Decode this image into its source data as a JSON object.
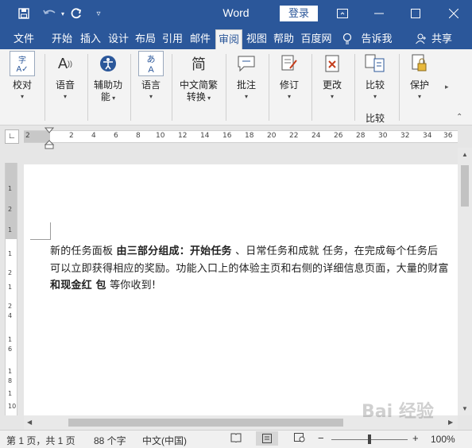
{
  "titlebar": {
    "title": "Word",
    "login_label": "登录",
    "icons": [
      "save-icon",
      "undo-icon",
      "redo-icon",
      "customize-icon",
      "ribbon-display-icon",
      "minimize-icon",
      "maximize-icon",
      "close-icon"
    ]
  },
  "tabs": [
    "文件",
    "开始",
    "插入",
    "设计",
    "布局",
    "引用",
    "邮件",
    "审阅",
    "视图",
    "帮助",
    "百度网",
    "告诉我",
    "共享"
  ],
  "active_tab": "审阅",
  "ribbon": {
    "proofing": {
      "label": "校对"
    },
    "speech": {
      "label": "语音"
    },
    "accessibility": {
      "label_line1": "辅助功",
      "label_line2": "能"
    },
    "language": {
      "label": "语言"
    },
    "chinese_conversion": {
      "label_line1": "中文简繁",
      "label_line2": "转换",
      "icon_text": "简"
    },
    "comments": {
      "label": "批注"
    },
    "tracking": {
      "label": "修订"
    },
    "changes": {
      "label": "更改"
    },
    "compare": {
      "label": "比较",
      "group_label": "比较"
    },
    "protect": {
      "label": "保护"
    }
  },
  "ruler": {
    "h_ticks": [
      "2",
      "2",
      "4",
      "6",
      "8",
      "10",
      "12",
      "14",
      "16",
      "18",
      "20",
      "22",
      "24",
      "26",
      "28",
      "30",
      "32",
      "34",
      "36"
    ],
    "v_ticks": [
      "1",
      "2",
      "1",
      "1",
      "2",
      "1",
      "2",
      "4",
      "1",
      "6",
      "1",
      "8",
      "1",
      "10"
    ]
  },
  "document": {
    "line1": {
      "a": "新的任务面板 ",
      "b": "由三部分组成：开始任务",
      "c": " 、日常任务和成就 任务，在完成每个任务后"
    },
    "line2": "可以立即获得相应的奖励。功能入口上的体验主页和右侧的详细信息页面，大量的财富",
    "line3": {
      "a": "和现金红 包",
      "b": " 等你收到!"
    }
  },
  "statusbar": {
    "page": "第 1 页，共 1 页",
    "words": "88 个字",
    "language": "中文(中国)",
    "zoom": "100%",
    "zoom_level": 100
  },
  "watermark": "Bai 经验"
}
